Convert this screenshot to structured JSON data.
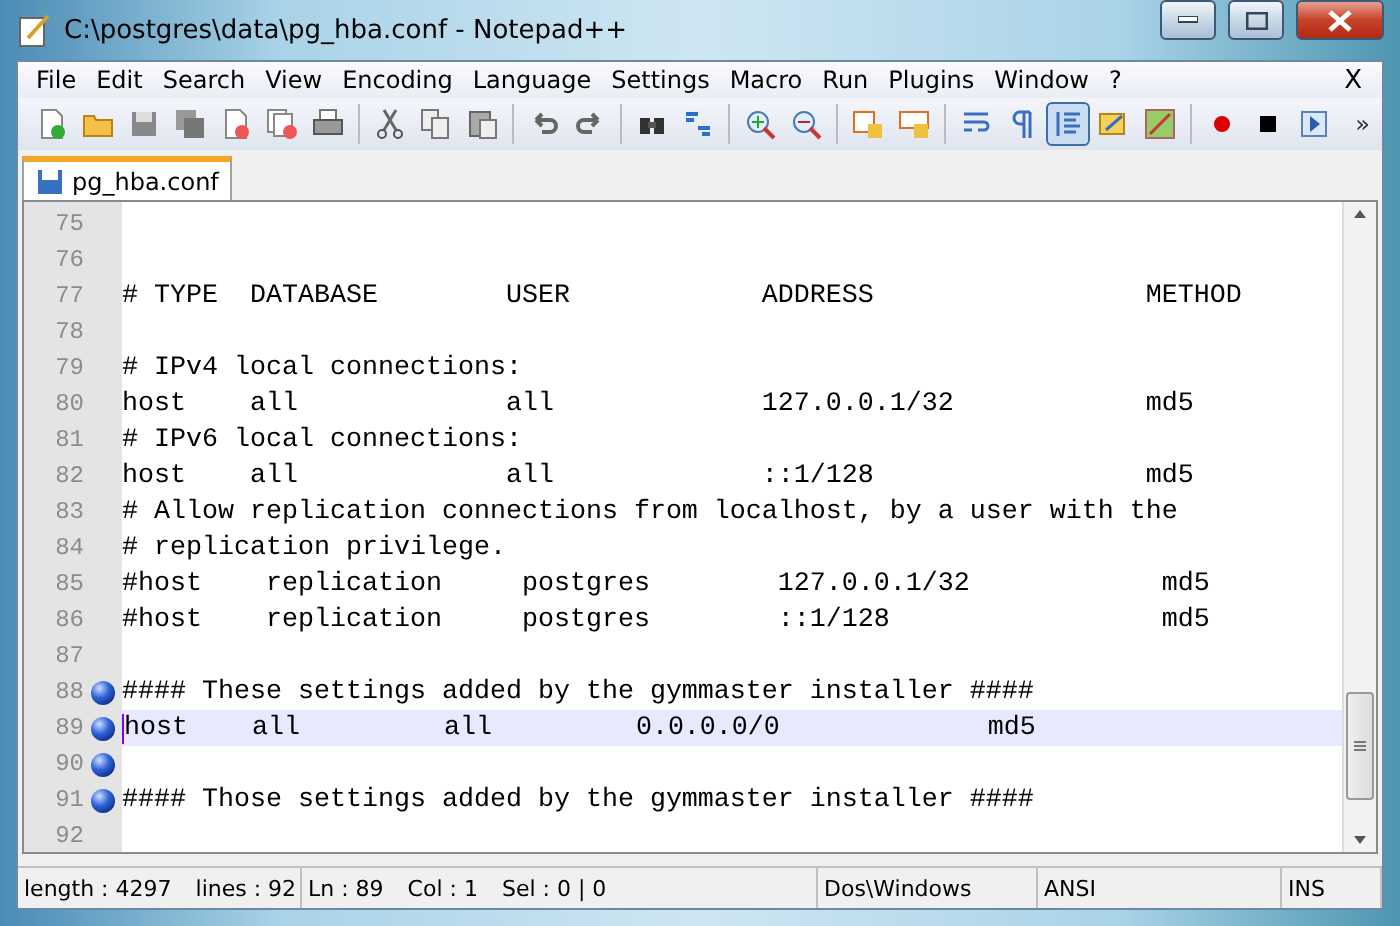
{
  "window": {
    "title": "C:\\postgres\\data\\pg_hba.conf - Notepad++"
  },
  "menu": [
    "File",
    "Edit",
    "Search",
    "View",
    "Encoding",
    "Language",
    "Settings",
    "Macro",
    "Run",
    "Plugins",
    "Window",
    "?"
  ],
  "menu_close": "X",
  "toolbar": [
    {
      "kind": "new",
      "pressed": false
    },
    {
      "kind": "open",
      "pressed": false
    },
    {
      "kind": "save",
      "pressed": false
    },
    {
      "kind": "saveall",
      "pressed": false
    },
    {
      "kind": "close",
      "pressed": false
    },
    {
      "kind": "closeall",
      "pressed": false
    },
    {
      "kind": "print",
      "pressed": false
    },
    {
      "kind": "sep"
    },
    {
      "kind": "cut",
      "pressed": false
    },
    {
      "kind": "copy",
      "pressed": false
    },
    {
      "kind": "paste",
      "pressed": false
    },
    {
      "kind": "sep"
    },
    {
      "kind": "undo",
      "pressed": false
    },
    {
      "kind": "redo",
      "pressed": false
    },
    {
      "kind": "sep"
    },
    {
      "kind": "find",
      "pressed": false
    },
    {
      "kind": "replace",
      "pressed": false
    },
    {
      "kind": "sep"
    },
    {
      "kind": "zoomin",
      "pressed": false
    },
    {
      "kind": "zoomout",
      "pressed": false
    },
    {
      "kind": "sep"
    },
    {
      "kind": "sync1",
      "pressed": false
    },
    {
      "kind": "sync2",
      "pressed": false
    },
    {
      "kind": "sep"
    },
    {
      "kind": "wrap",
      "pressed": false
    },
    {
      "kind": "pilcrow",
      "pressed": false
    },
    {
      "kind": "indent",
      "pressed": true
    },
    {
      "kind": "lang",
      "pressed": false
    },
    {
      "kind": "map",
      "pressed": false
    },
    {
      "kind": "sep"
    },
    {
      "kind": "record",
      "pressed": false
    },
    {
      "kind": "stop",
      "pressed": false
    },
    {
      "kind": "play",
      "pressed": false
    }
  ],
  "toolbar_more": "»",
  "tabs": [
    {
      "label": "pg_hba.conf",
      "selected": true
    }
  ],
  "editor": {
    "lines": [
      {
        "number": "75",
        "bookmark": false,
        "selected": false
      },
      {
        "number": "76",
        "bookmark": false,
        "selected": false
      },
      {
        "number": "77",
        "text": "# TYPE  DATABASE        USER            ADDRESS                 METHOD",
        "bookmark": false,
        "selected": false
      },
      {
        "number": "78",
        "bookmark": false,
        "selected": false
      },
      {
        "number": "79",
        "text": "# IPv4 local connections:",
        "bookmark": false,
        "selected": false
      },
      {
        "number": "80",
        "text": "host    all             all             127.0.0.1/32            md5",
        "bookmark": false,
        "selected": false
      },
      {
        "number": "81",
        "text": "# IPv6 local connections:",
        "bookmark": false,
        "selected": false
      },
      {
        "number": "82",
        "text": "host    all             all             ::1/128                 md5",
        "bookmark": false,
        "selected": false
      },
      {
        "number": "83",
        "text": "# Allow replication connections from localhost, by a user with the",
        "bookmark": false,
        "selected": false
      },
      {
        "number": "84",
        "text": "# replication privilege.",
        "bookmark": false,
        "selected": false
      },
      {
        "number": "85",
        "text": "#host    replication     postgres        127.0.0.1/32            md5",
        "bookmark": false,
        "selected": false
      },
      {
        "number": "86",
        "text": "#host    replication     postgres        ::1/128                 md5",
        "bookmark": false,
        "selected": false
      },
      {
        "number": "87",
        "bookmark": false,
        "selected": false
      },
      {
        "number": "88",
        "text": "#### These settings added by the gymmaster installer ####",
        "bookmark": true,
        "selected": false
      },
      {
        "number": "89",
        "text": "host    all         all         0.0.0.0/0             md5",
        "bookmark": true,
        "selected": true
      },
      {
        "number": "90",
        "bookmark": true,
        "selected": false
      },
      {
        "number": "91",
        "text": "#### Those settings added by the gymmaster installer ####",
        "bookmark": true,
        "selected": false
      },
      {
        "number": "92",
        "bookmark": false,
        "selected": false
      }
    ]
  },
  "status_bar": [
    [
      "length : 4297",
      "lines : 92"
    ],
    [
      "Ln : 89",
      "Col : 1",
      "Sel : 0 | 0"
    ],
    [
      "Dos\\Windows"
    ],
    [
      "ANSI"
    ],
    [
      "INS"
    ]
  ]
}
